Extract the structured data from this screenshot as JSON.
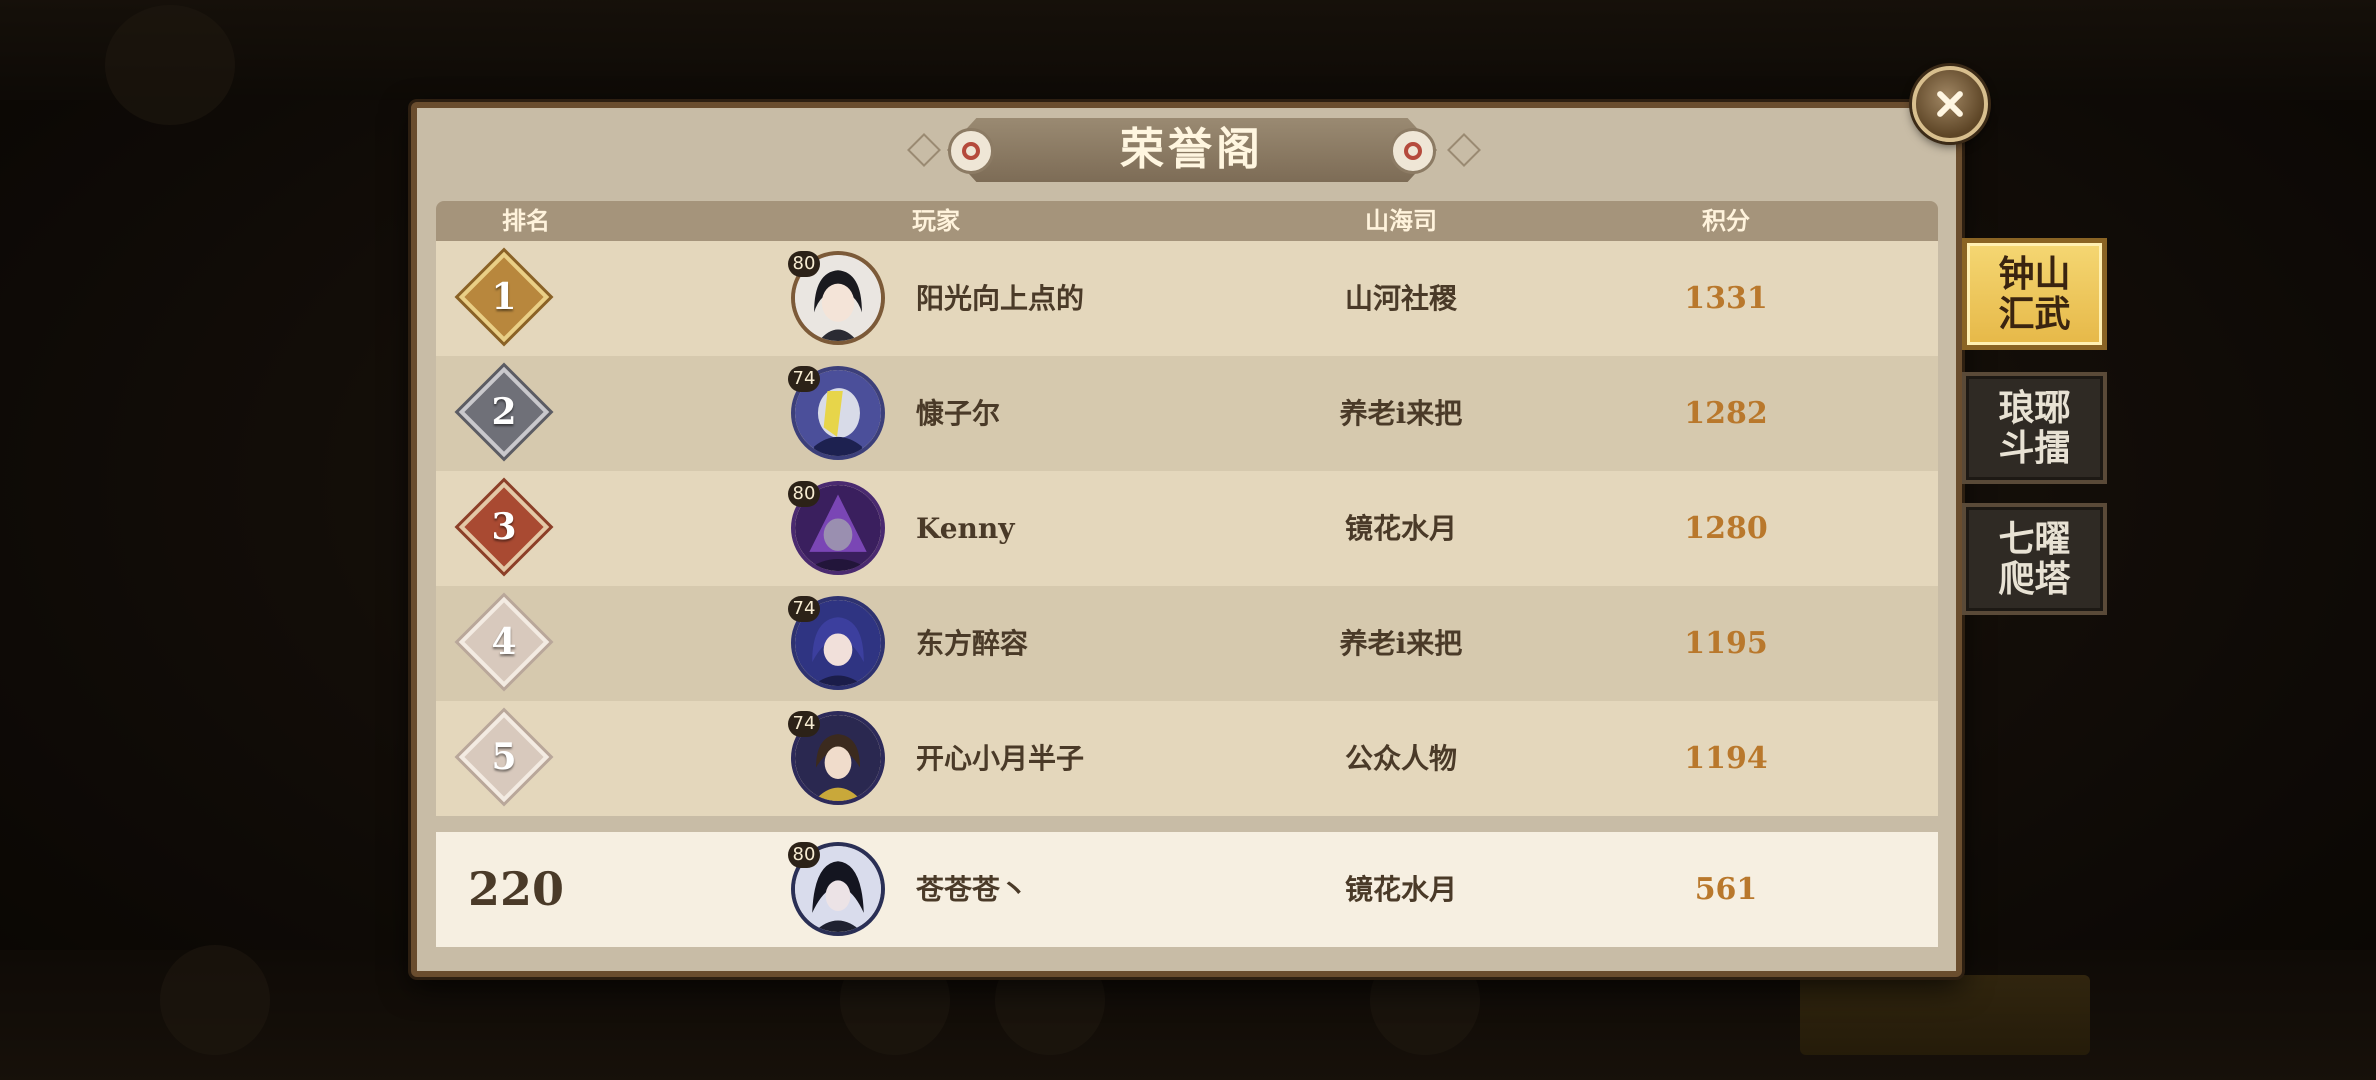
{
  "panel": {
    "title": "荣誉阁",
    "columns": {
      "rank": "排名",
      "player": "玩家",
      "guild": "山海司",
      "score": "积分"
    }
  },
  "rows": [
    {
      "rank": "1",
      "level": "80",
      "name": "阳光向上点的",
      "guild": "山河社稷",
      "score": "1331",
      "avatar": "avatar-black-hair"
    },
    {
      "rank": "2",
      "level": "74",
      "name": "慷子尔",
      "guild": "养老i来把",
      "score": "1282",
      "avatar": "avatar-silver-masked"
    },
    {
      "rank": "3",
      "level": "80",
      "name": "Kenny",
      "guild": "镜花水月",
      "score": "1280",
      "avatar": "avatar-purple-dark"
    },
    {
      "rank": "4",
      "level": "74",
      "name": "东方醉容",
      "guild": "养老i来把",
      "score": "1195",
      "avatar": "avatar-blue-hood"
    },
    {
      "rank": "5",
      "level": "74",
      "name": "开心小月半子",
      "guild": "公众人物",
      "score": "1194",
      "avatar": "avatar-brown-hair"
    }
  ],
  "my_row": {
    "rank": "220",
    "level": "80",
    "name": "苍苍苍丶",
    "guild": "镜花水月",
    "score": "561",
    "avatar": "avatar-dark-swordsman"
  },
  "side_tabs": [
    {
      "label": "钟山汇武",
      "active": true
    },
    {
      "label": "琅琊斗擂",
      "active": false
    },
    {
      "label": "七曜爬塔",
      "active": false
    }
  ],
  "colors": {
    "rank_gold": "#b8873d",
    "rank_silver": "#6f7078",
    "rank_bronze": "#a94a32",
    "rank_plain": "#d8c9bd",
    "score": "#b9782c"
  }
}
